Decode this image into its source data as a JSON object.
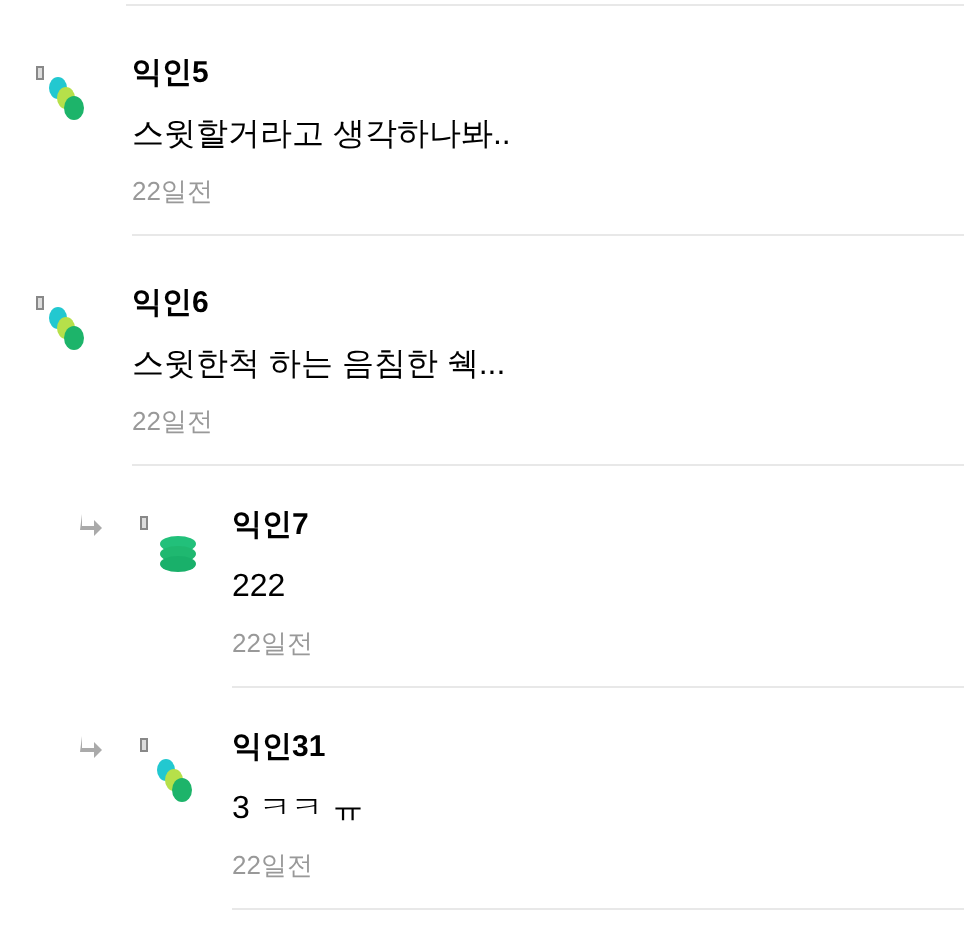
{
  "comments": [
    {
      "author": "익인5",
      "kind": "dots",
      "text": "스윗할거라고 생각하나봐..",
      "time": "22일전"
    },
    {
      "author": "익인6",
      "kind": "dots",
      "text": "스윗한척 하는 음침한 쉑...",
      "time": "22일전",
      "children": [
        {
          "author": "익인7",
          "kind": "stack",
          "text": "222",
          "time": "22일전"
        },
        {
          "author": "익인31",
          "kind": "dots",
          "text": "3 ㅋㅋ ㅠ",
          "time": "22일전"
        }
      ]
    }
  ]
}
